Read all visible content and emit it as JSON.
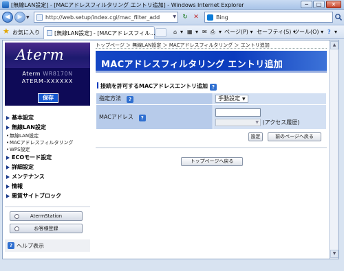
{
  "window": {
    "title": "[無線LAN設定] - [MACアドレスフィルタリング エントリ追加] - Windows Internet Explorer",
    "min": "─",
    "max": "□",
    "close": "✕"
  },
  "address_bar": {
    "back": "◀",
    "forward": "▶",
    "history_drop": "▼",
    "url": "http://web.setup/index.cgi/mac_filter_add",
    "url_drop": "▼",
    "refresh": "↻",
    "stop": "✕",
    "search_engine": "Bing",
    "search_icon": "search-icon"
  },
  "favorites_bar": {
    "favorites_label": "お気に入り",
    "tab_label": "[無線LAN設定] - [MACアドレスフィル...",
    "page_menu": "ページ(P)",
    "safety_menu": "セーフティ(S)",
    "tools_menu": "ツール(O)",
    "help_icon": "?",
    "drop": "▾"
  },
  "sidebar": {
    "brand": "Aterm",
    "model_line1": "Aterm",
    "model_line1_masked": "WR8170N",
    "model_line2": "ATERM-XXXXXX",
    "save_button": "保存",
    "menu": [
      {
        "label": "基本設定"
      },
      {
        "label": "無線LAN設定",
        "subs": [
          "無線LAN設定",
          "MACアドレスフィルタリング",
          "WPS設定"
        ]
      },
      {
        "label": "ECOモード設定"
      },
      {
        "label": "詳細設定"
      },
      {
        "label": "メンテナンス"
      },
      {
        "label": "情報"
      },
      {
        "label": "悪質サイトブロック"
      }
    ],
    "atermstation_button": "AtermStation",
    "register_button": "お客様登録",
    "help": "ヘルプ表示"
  },
  "main": {
    "breadcrumb": "トップページ ＞ 無線LAN設定 ＞ MACアドレスフィルタリング ＞ エントリ追加",
    "header": "MACアドレスフィルタリング エントリ追加",
    "section_title": "接続を許可するMACアドレスエントリ追加",
    "rows": {
      "method_label": "指定方法",
      "method_value": "手動設定",
      "mac_label": "MACアドレス",
      "mac_value": "",
      "history_suffix": "(アクセス履歴)"
    },
    "set_button": "設定",
    "back_button": "前のページへ戻る",
    "top_button": "トップページへ戻る"
  },
  "colors": {
    "header_bg": "#0b3bbd",
    "label_bg": "#b7cbea",
    "value_bg": "#d3e0f3",
    "sidebar_dark": "#0e0a57"
  }
}
